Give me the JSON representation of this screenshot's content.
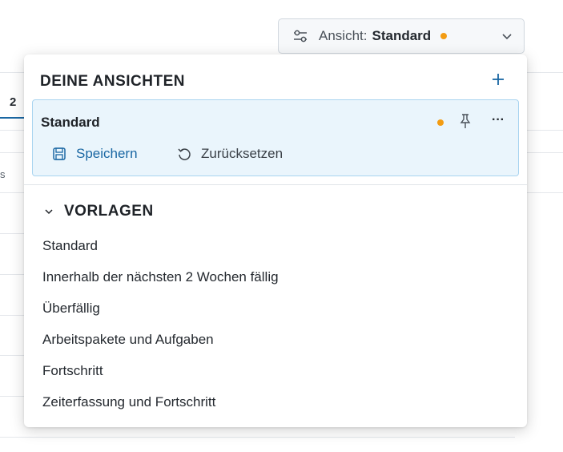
{
  "background": {
    "tab_number": "2",
    "fragment": "s"
  },
  "view_selector": {
    "label": "Ansicht:",
    "value": "Standard",
    "icons": {
      "filter": "sliders-icon",
      "chevron": "chevron-down-icon"
    },
    "unsaved_dot_color": "#f39c12"
  },
  "dropdown": {
    "my_views": {
      "title": "DEINE ANSICHTEN",
      "add_icon": "plus-icon",
      "current": {
        "name": "Standard",
        "unsaved_dot_color": "#f39c12",
        "pin_icon": "pin-icon",
        "more_label": "···",
        "save_label": "Speichern",
        "reset_label": "Zurücksetzen"
      }
    },
    "templates": {
      "title": "VORLAGEN",
      "items": [
        "Standard",
        "Innerhalb der nächsten 2 Wochen fällig",
        "Überfällig",
        "Arbeitspakete und Aufgaben",
        "Fortschritt",
        "Zeiterfassung und Fortschritt"
      ]
    }
  },
  "colors": {
    "accent": "#1a67a3",
    "card_bg": "#eaf5fc",
    "card_border": "#a9d4f0",
    "warning_dot": "#f39c12"
  }
}
